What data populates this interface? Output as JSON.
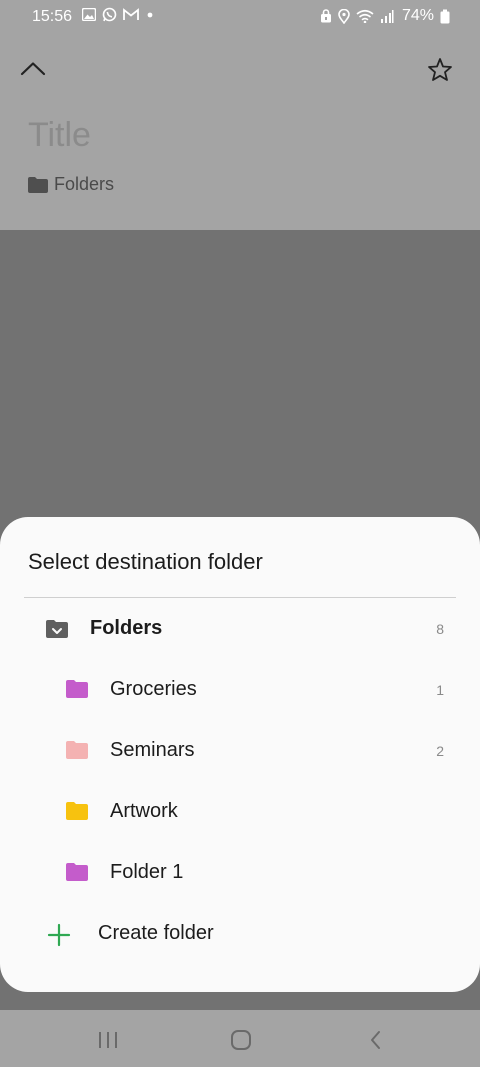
{
  "status_bar": {
    "time": "15:56",
    "battery": "74%",
    "left_icons": [
      "gallery-icon",
      "whatsapp-icon",
      "gmail-icon",
      "dot-icon"
    ],
    "right_icons": [
      "lock-icon",
      "location-icon",
      "wifi-icon",
      "signal-icon",
      "battery-icon"
    ]
  },
  "header": {
    "title_placeholder": "Title",
    "breadcrumb": "Folders"
  },
  "sheet": {
    "heading": "Select destination folder",
    "root": {
      "label": "Folders",
      "count": "8"
    },
    "folders": [
      {
        "label": "Groceries",
        "count": "1",
        "color": "#c45ccb"
      },
      {
        "label": "Seminars",
        "count": "2",
        "color": "#f4b2b2"
      },
      {
        "label": "Artwork",
        "count": "",
        "color": "#f7c20f"
      },
      {
        "label": "Folder 1",
        "count": "",
        "color": "#c45ccb"
      }
    ],
    "create_label": "Create folder",
    "accent": "#2fa852"
  },
  "nav_bar": {
    "icons": [
      "recent-apps-icon",
      "home-icon",
      "back-icon"
    ]
  }
}
